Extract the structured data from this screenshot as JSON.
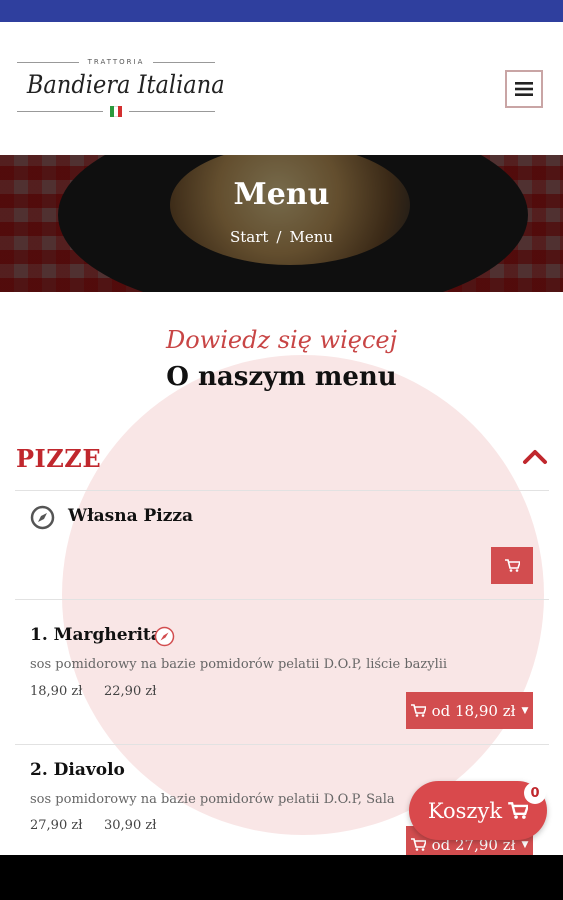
{
  "header": {
    "logo_small": "TRATTORIA",
    "logo_brand": "Bandiera Italiana",
    "flag_colors": [
      "#2a9a3d",
      "#ffffff",
      "#d32f2f"
    ]
  },
  "hero": {
    "title": "Menu",
    "breadcrumb": {
      "home": "Start",
      "separator": "/",
      "current": "Menu"
    }
  },
  "intro": {
    "subtitle": "Dowiedz się więcej",
    "title": "O naszym menu"
  },
  "category": {
    "name": "PIZZE"
  },
  "items": [
    {
      "name": "Własna Pizza"
    },
    {
      "name": "1. Margherita",
      "description": "sos pomidorowy na bazie pomidorów pelatii D.O.P, liście bazylii",
      "prices": [
        "18,90 zł",
        "22,90 zł"
      ],
      "order_label": "od 18,90 zł"
    },
    {
      "name": "2. Diavolo",
      "description": "sos pomidorowy na bazie pomidorów pelatii D.O.P, Sala",
      "prices": [
        "27,90 zł",
        "30,90 zł"
      ],
      "order_label": "od 27,90 zł"
    }
  ],
  "cart": {
    "label": "Koszyk",
    "count": "0"
  },
  "colors": {
    "accent": "#c0272d",
    "button": "#d24d4f",
    "status_bar": "#2f3f9e"
  }
}
